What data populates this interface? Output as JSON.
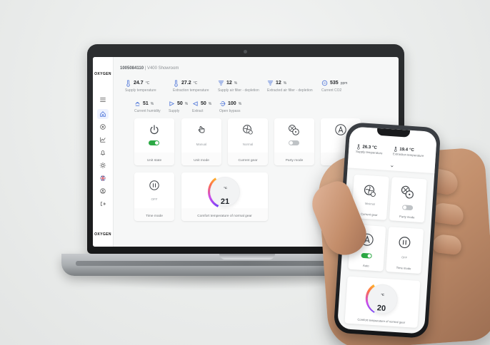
{
  "laptop_dashboard": {
    "serial": "1005084110",
    "device_name": "V400 Showroom",
    "brand_logo": "OXYGEN",
    "metrics_row_1": [
      {
        "value": "24.7",
        "unit": "°C",
        "label": "Supply temperature",
        "icon": "thermometer-icon"
      },
      {
        "value": "27.2",
        "unit": "°C",
        "label": "Extraction temperature",
        "icon": "thermometer-icon"
      },
      {
        "value": "12",
        "unit": "%",
        "label": "Supply air filter - depletion",
        "icon": "filter-icon"
      },
      {
        "value": "12",
        "unit": "%",
        "label": "Extracted air filter - depletion",
        "icon": "filter-icon"
      },
      {
        "value": "535",
        "unit": "ppm",
        "label": "Current CO2",
        "icon": "co2-icon"
      }
    ],
    "metrics_row_2": [
      {
        "value": "51",
        "unit": "%",
        "label": "Current humidity",
        "icon": "humidity-icon"
      },
      {
        "value": "50",
        "unit": "%",
        "label": "Supply",
        "icon": "fan-speed-icon"
      },
      {
        "value": "50",
        "unit": "%",
        "label": "Extract",
        "icon": "fan-speed-icon"
      },
      {
        "value": "100",
        "unit": "%",
        "label": "Open bypass",
        "icon": "bypass-icon"
      }
    ],
    "cards": [
      {
        "label": "Unit state",
        "inner_label": "",
        "toggle": "on",
        "icon": "power-icon"
      },
      {
        "label": "Unit mode",
        "inner_label": "Manual",
        "toggle": "",
        "icon": "hand-pointer-icon"
      },
      {
        "label": "Current gear",
        "inner_label": "Normal",
        "toggle": "",
        "icon": "fan-gear-icon"
      },
      {
        "label": "Party mode",
        "inner_label": "",
        "toggle": "off",
        "icon": "party-fan-icon"
      },
      {
        "label": "",
        "inner_label": "",
        "toggle": "",
        "icon": "auto-icon"
      },
      {
        "label": "Time mode",
        "inner_label": "OFF",
        "toggle": "",
        "icon": "pause-icon"
      },
      {
        "label": "Comfort temperature of normal gear",
        "inner_label": "",
        "toggle": "",
        "icon": "temperature-dial"
      }
    ],
    "comfort_temperature": "21",
    "comfort_unit": "°C",
    "sidebar_icons": [
      "menu-icon",
      "home-icon",
      "radar-icon",
      "chart-icon",
      "bell-icon",
      "settings-icon",
      "uk-flag-icon",
      "user-icon",
      "logout-icon"
    ],
    "colors": {
      "accent_green": "#2ba944",
      "accent_blue": "#4b73d8",
      "dial_start": "#7a46ff",
      "dial_end": "#ffb32c"
    }
  },
  "phone_dashboard": {
    "metrics": [
      {
        "value": "26.3",
        "unit": "°C",
        "label": "Supply temperature",
        "icon": "thermometer-icon"
      },
      {
        "value": "19.4",
        "unit": "°C",
        "label": "Extraction temperature",
        "icon": "thermometer-icon"
      }
    ],
    "cards": [
      {
        "label": "Current gear",
        "inner_label": "Minimal",
        "toggle": "",
        "icon": "fan-gear-icon"
      },
      {
        "label": "Party mode",
        "inner_label": "",
        "toggle": "off",
        "icon": "party-fan-icon"
      },
      {
        "label": "Auto",
        "inner_label": "",
        "toggle": "on",
        "icon": "auto-icon"
      },
      {
        "label": "Time mode",
        "inner_label": "OFF",
        "toggle": "",
        "icon": "pause-icon"
      },
      {
        "label": "Comfort temperature of normal gear",
        "inner_label": "",
        "toggle": "",
        "icon": "temperature-dial"
      }
    ],
    "comfort_temperature": "20",
    "comfort_unit": "°C"
  }
}
